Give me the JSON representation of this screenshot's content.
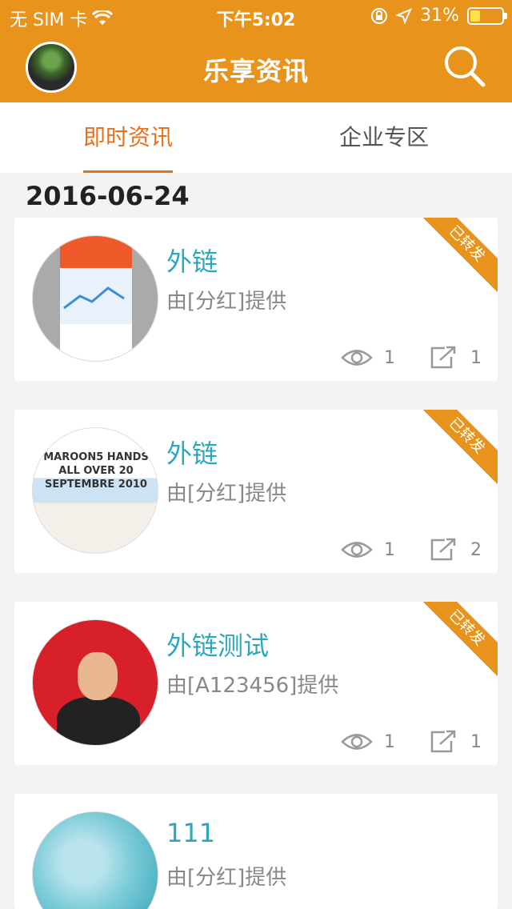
{
  "status_bar": {
    "carrier": "无 SIM 卡",
    "time": "下午5:02",
    "battery": "31%",
    "battery_level": 0.31
  },
  "nav": {
    "title": "乐享资讯",
    "avatar_icon": "user-avatar",
    "search_icon": "search-icon"
  },
  "tabs": [
    {
      "label": "即时资讯",
      "active": true
    },
    {
      "label": "企业专区",
      "active": false
    }
  ],
  "date_header": "2016-06-24",
  "cards": [
    {
      "title": "外链",
      "source": "由[分红]提供",
      "badge": "已转发",
      "views": "1",
      "shares": "1"
    },
    {
      "title": "外链",
      "source": "由[分红]提供",
      "badge": "已转发",
      "views": "1",
      "shares": "2",
      "thumb_text": "MAROON5 HANDS ALL OVER 20 SEPTEMBRE 2010"
    },
    {
      "title": "外链测试",
      "source": "由[A123456]提供",
      "badge": "已转发",
      "views": "1",
      "shares": "1"
    },
    {
      "title": "111",
      "source": "由[分红]提供"
    }
  ],
  "colors": {
    "accent": "#e8941c",
    "tab_active": "#e8711c",
    "title": "#2ca7bd"
  }
}
